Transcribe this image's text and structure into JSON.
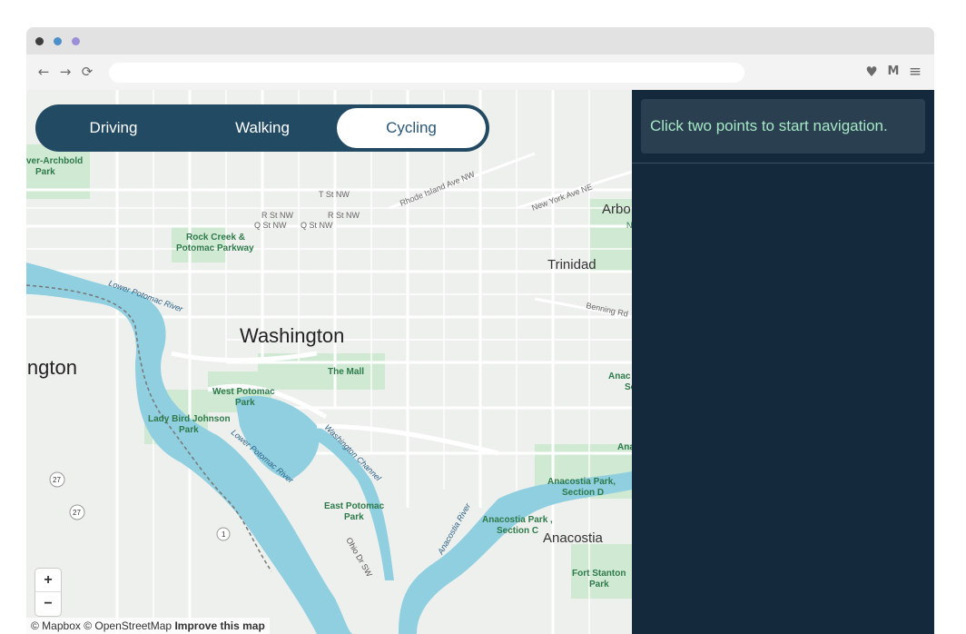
{
  "browser": {
    "back_icon": "←",
    "forward_icon": "→",
    "reload_icon": "⟳",
    "heart_icon": "♥",
    "mail_icon": "M",
    "menu_icon": "≡"
  },
  "modes": [
    {
      "label": "Driving",
      "selected": false
    },
    {
      "label": "Walking",
      "selected": false
    },
    {
      "label": "Cycling",
      "selected": true
    }
  ],
  "map": {
    "labels": {
      "washington": "Washington",
      "arlington": "ington",
      "the_mall": "The Mall",
      "trinidad": "Trinidad",
      "arbor": "Arbo",
      "anacostia": "Anacostia",
      "rock_creek_1": "Rock Creek &",
      "rock_creek_2": "Potomac Parkway",
      "archbold_1": "ver-Archbold",
      "archbold_2": "Park",
      "west_potomac_1": "West Potomac",
      "west_potomac_2": "Park",
      "east_potomac_1": "East Potomac",
      "east_potomac_2": "Park",
      "lbj_1": "Lady Bird Johnson",
      "lbj_2": "Park",
      "anacostia_d_1": "Anacostia Park,",
      "anacostia_d_2": "Section D",
      "anacostia_c_1": "Anacostia Park ,",
      "anacostia_c_2": "Section C",
      "fort_stanton_1": "Fort Stanton",
      "fort_stanton_2": "Park",
      "lower_potomac_river": "Lower Potomac River",
      "washington_channel": "Washington Channel",
      "anacostia_river": "Anacostia River",
      "ohio_dr": "Ohio Dr SW",
      "rhode_island": "Rhode Island Ave NW",
      "new_york_ave": "New York Ave NE",
      "benning_rd": "Benning Rd",
      "t_st": "T St NW",
      "r_st_1": "R St NW",
      "r_st_2": "R St NW",
      "q_st_1": "Q St NW",
      "q_st_2": "Q St NW",
      "route_27a": "27",
      "route_27b": "27",
      "route_1": "1",
      "ana_s": "Anac",
      "ana_s2": "Se",
      "ana_s3": "Ana",
      "n_label": "N"
    },
    "zoom_in": "+",
    "zoom_out": "−",
    "attribution": {
      "mapbox": "© Mapbox",
      "osm": "© OpenStreetMap",
      "improve": "Improve this map"
    }
  },
  "panel": {
    "message": "Click two points to start navigation."
  }
}
